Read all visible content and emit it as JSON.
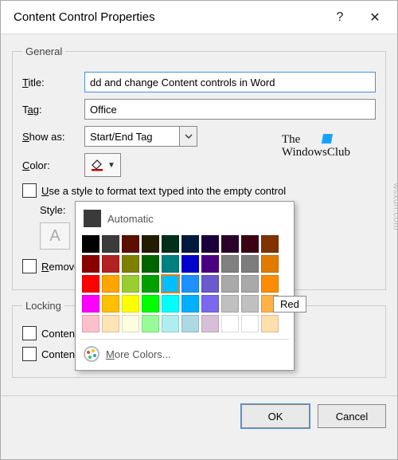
{
  "dialog": {
    "title": "Content Control Properties",
    "help_icon": "?",
    "close_icon": "✕"
  },
  "general": {
    "legend": "General",
    "title_label": "Title:",
    "title_value": "dd and change Content controls in Word",
    "tag_label": "Tag:",
    "tag_value": "Office",
    "show_as_label": "Show as:",
    "show_as_value": "Start/End Tag",
    "color_label": "Color:",
    "use_style_label": "Use a style to format text typed into the empty control",
    "style_label": "Style:",
    "new_style_btn": "A",
    "remove_label": "Remove content control when contents are edited"
  },
  "locking": {
    "legend": "Locking",
    "cannot_delete": "Content control cannot be deleted",
    "cannot_edit": "Contents cannot be edited"
  },
  "buttons": {
    "ok": "OK",
    "cancel": "Cancel"
  },
  "color_picker": {
    "automatic": "Automatic",
    "more_colors": "More Colors...",
    "tooltip": "Red",
    "colors": [
      "#000000",
      "#3b3b3b",
      "#5b0f00",
      "#221b00",
      "#002f1a",
      "#001a3b",
      "#1a003b",
      "#2b002b",
      "#3b0012",
      "#803300",
      "#8b0000",
      "#b22222",
      "#808000",
      "#006400",
      "#008080",
      "#0000cd",
      "#4b0082",
      "#808080",
      "#7d7d7d",
      "#e07b00",
      "#ff0000",
      "#ffa500",
      "#9acd32",
      "#00a000",
      "#00bfff",
      "#1e90ff",
      "#6a5acd",
      "#a9a9a9",
      "#a9a9a9",
      "#ff8c00",
      "#ff00ff",
      "#ffc000",
      "#ffff00",
      "#00ff00",
      "#00ffff",
      "#00b0ff",
      "#7b68ee",
      "#c0c0c0",
      "#c0c0c0",
      "#ffb347",
      "#ffc0cb",
      "#ffe4b5",
      "#ffffe0",
      "#98fb98",
      "#afeeee",
      "#add8e6",
      "#d8bfd8",
      "#ffffff",
      "#ffffff",
      "#ffdead"
    ],
    "selected_index": 24
  },
  "watermark": {
    "line1": "The",
    "line2": "WindowsClub",
    "side": "wsxdn.com"
  }
}
